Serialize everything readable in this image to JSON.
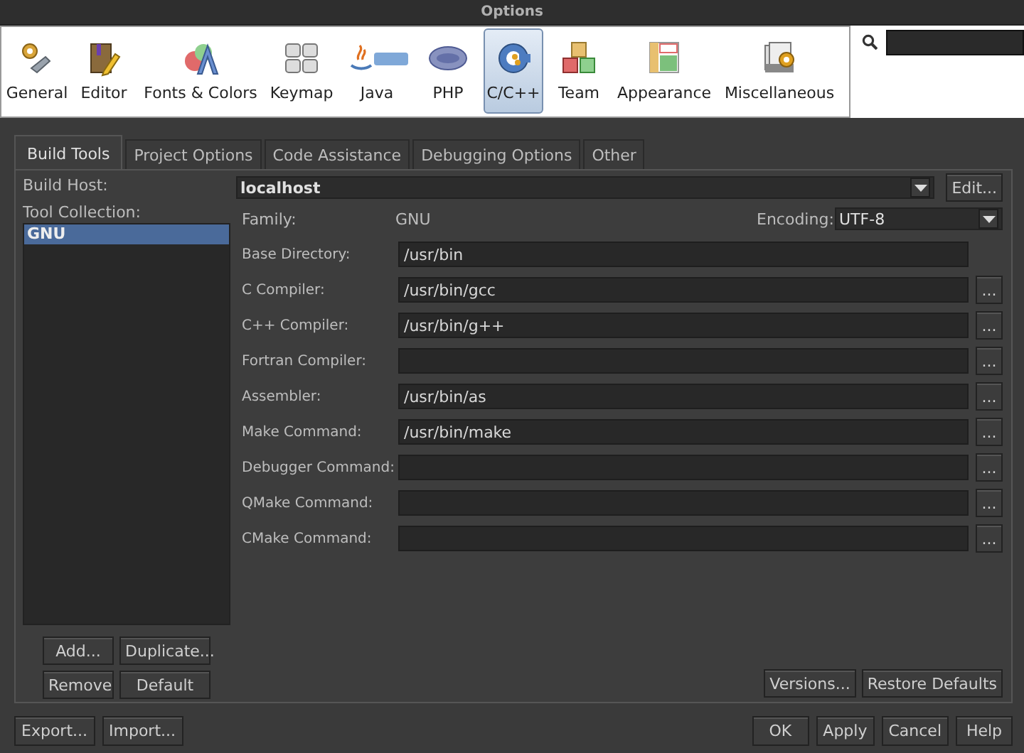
{
  "window": {
    "title": "Options"
  },
  "categories": [
    {
      "label": "General",
      "selected": false
    },
    {
      "label": "Editor",
      "selected": false
    },
    {
      "label": "Fonts & Colors",
      "selected": false
    },
    {
      "label": "Keymap",
      "selected": false
    },
    {
      "label": "Java",
      "selected": false
    },
    {
      "label": "PHP",
      "selected": false
    },
    {
      "label": "C/C++",
      "selected": true
    },
    {
      "label": "Team",
      "selected": false
    },
    {
      "label": "Appearance",
      "selected": false
    },
    {
      "label": "Miscellaneous",
      "selected": false
    }
  ],
  "tabs": [
    {
      "label": "Build Tools",
      "selected": true
    },
    {
      "label": "Project Options",
      "selected": false
    },
    {
      "label": "Code Assistance",
      "selected": false
    },
    {
      "label": "Debugging Options",
      "selected": false
    },
    {
      "label": "Other",
      "selected": false
    }
  ],
  "build_host": {
    "label": "Build Host:",
    "value": "localhost",
    "button": "Edit..."
  },
  "tool_collection": {
    "label": "Tool Collection:",
    "items": [
      {
        "label": "GNU",
        "selected": true
      }
    ],
    "buttons": [
      "Add...",
      "Duplicate...",
      "Remove",
      "Default"
    ]
  },
  "family": {
    "label": "Family:",
    "value": "GNU"
  },
  "encoding": {
    "label": "Encoding:",
    "value": "UTF-8"
  },
  "fields": [
    {
      "label": "Base Directory:",
      "value": "/usr/bin",
      "browse": false
    },
    {
      "label": "C Compiler:",
      "value": "/usr/bin/gcc",
      "browse": true
    },
    {
      "label": "C++ Compiler:",
      "value": "/usr/bin/g++",
      "browse": true
    },
    {
      "label": "Fortran Compiler:",
      "browse": true
    },
    {
      "label": "Assembler:",
      "value": "/usr/bin/as",
      "browse": true
    },
    {
      "label": "Make Command:",
      "value": "/usr/bin/make",
      "browse": true
    },
    {
      "label": "Debugger Command:",
      "browse": true
    },
    {
      "label": "QMake Command:",
      "browse": true
    },
    {
      "label": "CMake Command:",
      "browse": true
    }
  ],
  "browse_label": "...",
  "panel_buttons": [
    "Versions...",
    "Restore Defaults"
  ],
  "footer_left": [
    "Export...",
    "Import..."
  ],
  "footer_right": [
    "OK",
    "Apply",
    "Cancel",
    "Help"
  ]
}
